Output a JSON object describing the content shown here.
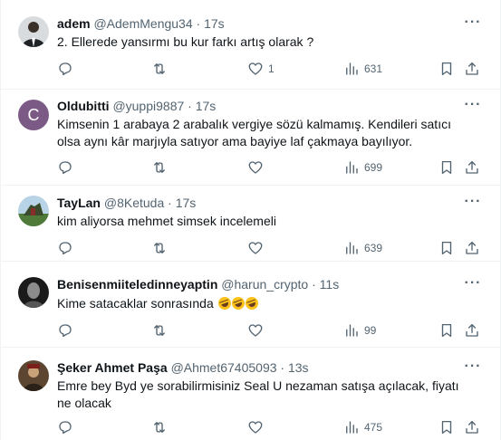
{
  "tweets": [
    {
      "name": "adem",
      "handle": "@AdemMengu34",
      "sep": "·",
      "time": "17s",
      "text": "2. Ellerede yansırmı bu kur farkı artış olarak ?",
      "replies": "",
      "retweets": "",
      "likes": "1",
      "views": "631"
    },
    {
      "name": "Oldubitti",
      "handle": "@yuppi9887",
      "sep": "·",
      "time": "17s",
      "text": "Kimsenin 1 arabaya 2 arabalık vergiye sözü kalmamış. Kendileri satıcı olsa aynı kâr marjıyla satıyor ama bayiye laf çakmaya bayılıyor.",
      "replies": "",
      "retweets": "",
      "likes": "",
      "views": "699"
    },
    {
      "name": "TayLan",
      "handle": "@8Ketuda",
      "sep": "·",
      "time": "17s",
      "text": "kim aliyorsa mehmet simsek incelemeli",
      "replies": "",
      "retweets": "",
      "likes": "",
      "views": "639"
    },
    {
      "name": "Benisenmiiteledinneyaptin",
      "handle": "@harun_crypto",
      "sep": "·",
      "time": "11s",
      "text": "Kime satacaklar sonrasında",
      "emoji_count": 3,
      "replies": "",
      "retweets": "",
      "likes": "",
      "views": "99"
    },
    {
      "name": "Şeker Ahmet Paşa",
      "handle": "@Ahmet67405093",
      "sep": "·",
      "time": "13s",
      "text": "Emre bey Byd ye sorabilirmisiniz Seal U nezaman satışa açılacak, fiyatı ne olacak",
      "replies": "",
      "retweets": "",
      "likes": "",
      "views": "475"
    }
  ],
  "oldubitti_avatar_letter": "C",
  "icons": {
    "reply": "reply-icon",
    "retweet": "retweet-icon",
    "like": "like-icon",
    "views": "views-icon",
    "bookmark": "bookmark-icon",
    "share": "share-icon",
    "more": "more-icon"
  },
  "colors": {
    "text": "#0f1419",
    "secondary": "#536471",
    "divider": "#eff3f4",
    "avatar_purple": "#7b5a86"
  }
}
